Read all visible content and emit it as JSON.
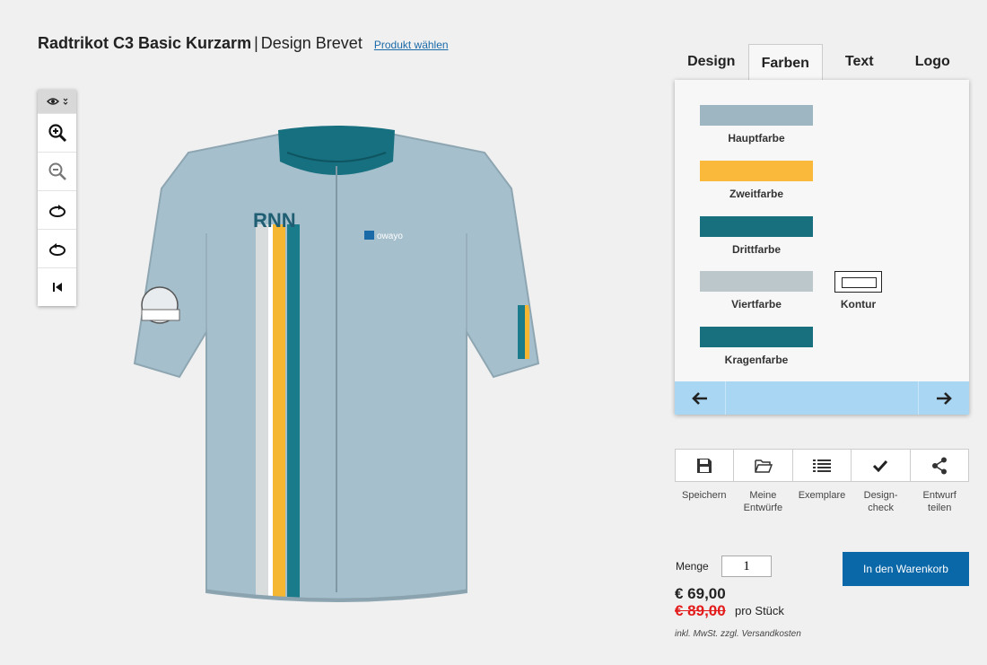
{
  "header": {
    "product": "Radtrikot C3 Basic Kurzarm",
    "separator": "|",
    "design": "Design Brevet",
    "choose_link": "Produkt wählen"
  },
  "toolbar": {
    "tools": [
      "eye-icon",
      "zoom-in-icon",
      "zoom-out-icon",
      "rotate-right-icon",
      "rotate-left-icon",
      "reset-icon"
    ]
  },
  "jersey": {
    "name_print": "RNN",
    "brand_print": "owayo",
    "colors": {
      "main": "#a5bfcc",
      "secondary": "#f5b731",
      "third": "#1a7b8a",
      "fourth": "#d9dcdd",
      "collar": "#17707f"
    }
  },
  "tabs": [
    "Design",
    "Farben",
    "Text",
    "Logo"
  ],
  "active_tab": "Farben",
  "colors_panel": {
    "swatches": [
      {
        "label": "Hauptfarbe",
        "color": "#9db6c2"
      },
      {
        "label": "Zweitfarbe",
        "color": "#fbb93b"
      },
      {
        "label": "Drittfarbe",
        "color": "#18707f"
      },
      {
        "label": "Viertfarbe",
        "color": "#bcc7cb"
      },
      {
        "label": "Kragenfarbe",
        "color": "#18707f"
      }
    ],
    "kontur_label": "Kontur",
    "nav_icons": [
      "arrow-left-icon",
      "arrow-right-icon"
    ]
  },
  "actions": [
    {
      "label": "Speichern",
      "icon": "save-icon"
    },
    {
      "label": "Meine\nEntwürfe",
      "icon": "folder-icon"
    },
    {
      "label": "Exemplare",
      "icon": "list-icon"
    },
    {
      "label": "Design-\ncheck",
      "icon": "check-icon"
    },
    {
      "label": "Entwurf\nteilen",
      "icon": "share-icon"
    }
  ],
  "purchase": {
    "quantity_label": "Menge",
    "quantity_value": "1",
    "cart_button": "In den Warenkorb",
    "price": "€ 69,00",
    "old_price": "€ 89,00",
    "per_piece": "pro Stück",
    "tax_note": "inkl. MwSt. zzgl. Versandkosten"
  }
}
